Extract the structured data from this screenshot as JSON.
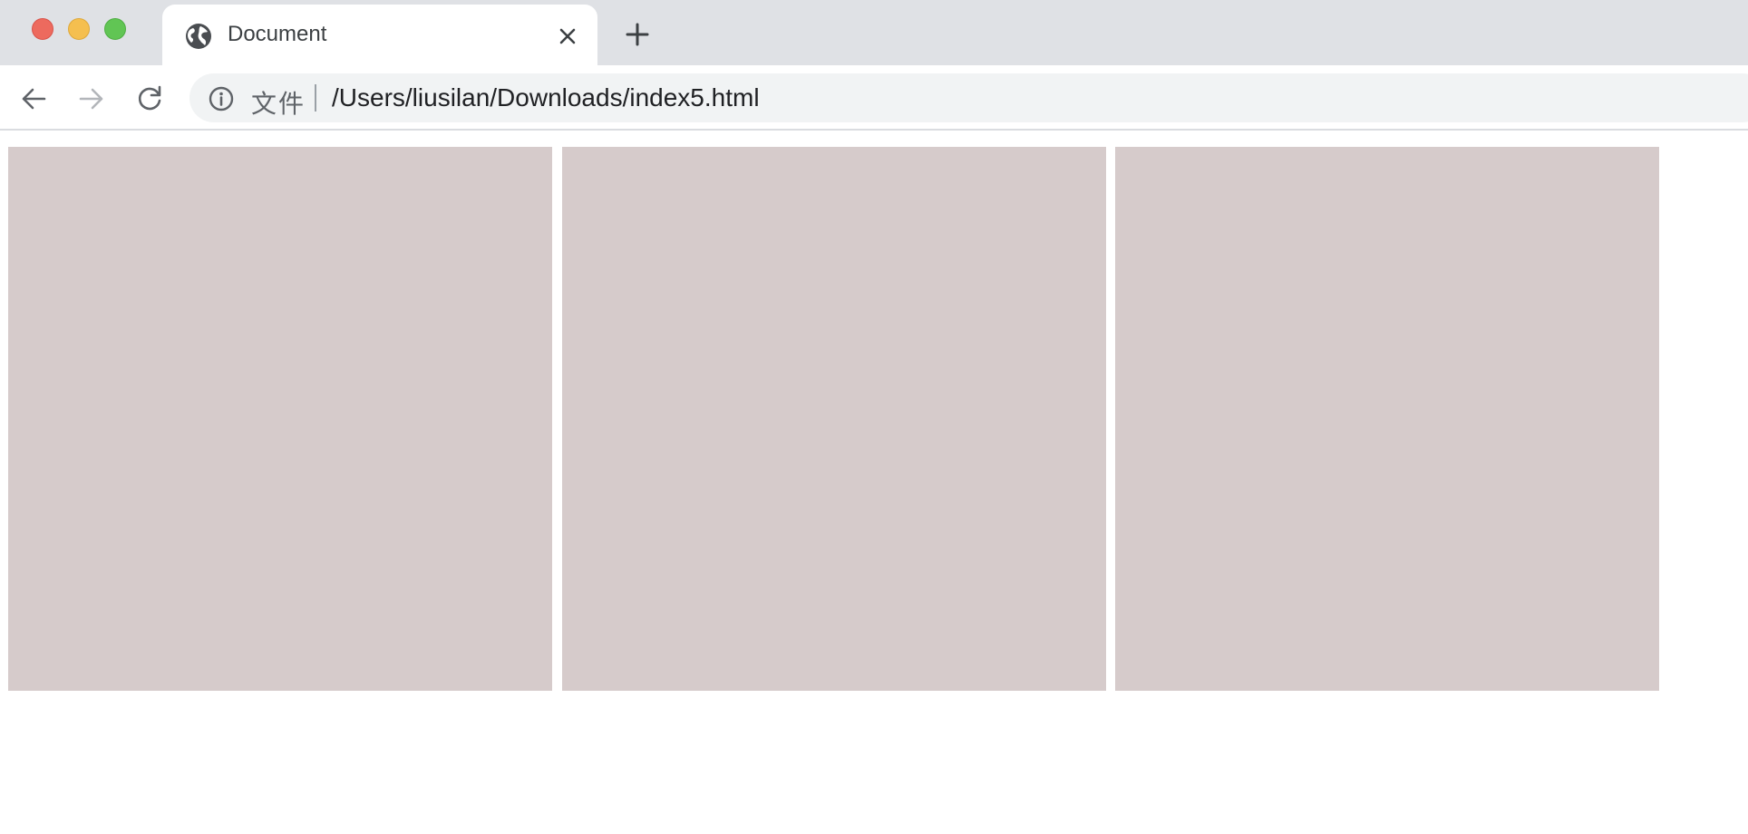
{
  "window": {
    "controls": [
      "close",
      "minimize",
      "maximize"
    ],
    "colors": {
      "close": "#ed6a5e",
      "minimize": "#f5bf4f",
      "maximize": "#61c554"
    }
  },
  "tab": {
    "title": "Document",
    "icon": "globe-icon"
  },
  "toolbar": {
    "back_icon": "arrow-left-icon",
    "forward_icon": "arrow-right-icon",
    "reload_icon": "reload-icon"
  },
  "address_bar": {
    "info_icon": "info-icon",
    "scheme_label": "文件",
    "url": "/Users/liusilan/Downloads/index5.html"
  },
  "page": {
    "boxes": [
      {
        "color": "#d6cbcb"
      },
      {
        "color": "#d6cbcb"
      },
      {
        "color": "#d6cbcb"
      }
    ]
  }
}
